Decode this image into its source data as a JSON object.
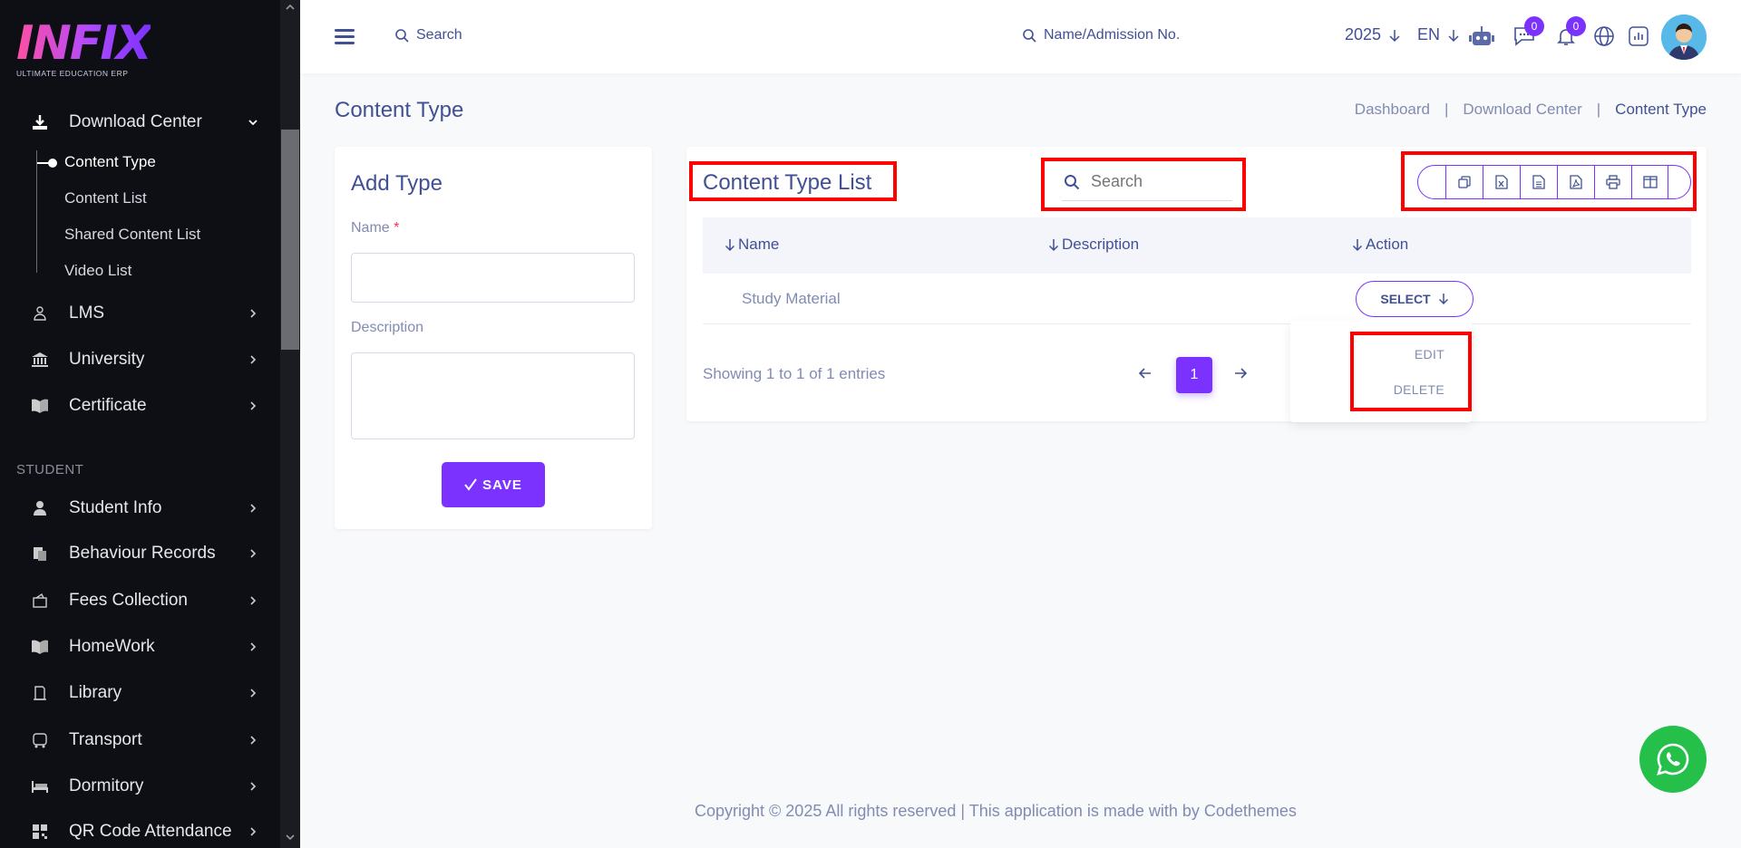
{
  "brand": {
    "logo_text": "INFIX",
    "tagline": "ULTIMATE EDUCATION ERP"
  },
  "sidebar": {
    "open_section": {
      "label": "Download Center",
      "icon": "download-icon"
    },
    "sub_items": [
      {
        "label": "Content Type",
        "active": true
      },
      {
        "label": "Content List"
      },
      {
        "label": "Shared Content List"
      },
      {
        "label": "Video List"
      }
    ],
    "items_top": [
      {
        "label": "LMS",
        "icon": "lms-icon"
      },
      {
        "label": "University",
        "icon": "university-icon"
      },
      {
        "label": "Certificate",
        "icon": "certificate-icon"
      }
    ],
    "section_student": "STUDENT",
    "items_student": [
      {
        "label": "Student Info",
        "icon": "student-icon"
      },
      {
        "label": "Behaviour Records",
        "icon": "behaviour-icon"
      },
      {
        "label": "Fees Collection",
        "icon": "fees-icon"
      },
      {
        "label": "HomeWork",
        "icon": "homework-icon"
      },
      {
        "label": "Library",
        "icon": "library-icon"
      },
      {
        "label": "Transport",
        "icon": "transport-icon"
      },
      {
        "label": "Dormitory",
        "icon": "dormitory-icon"
      },
      {
        "label": "QR Code Attendance",
        "icon": "qr-code-icon"
      }
    ]
  },
  "header": {
    "search_label": "Search",
    "student_search_label": "Name/Admission No.",
    "year": "2025",
    "language": "EN",
    "message_count": "0",
    "notification_count": "0"
  },
  "page": {
    "title": "Content Type",
    "breadcrumb": [
      "Dashboard",
      "Download Center",
      "Content Type"
    ],
    "separator": "|"
  },
  "add_form": {
    "title": "Add Type",
    "name_label": "Name",
    "required_mark": "*",
    "name_value": "",
    "description_label": "Description",
    "description_value": "",
    "save_label": "SAVE",
    "save_icon": "check-icon"
  },
  "list": {
    "title": "Content Type List",
    "search_placeholder": "Search",
    "export_buttons": [
      "copy-icon",
      "excel-icon",
      "csv-icon",
      "pdf-icon",
      "print-icon",
      "columns-icon"
    ],
    "columns": [
      "Name",
      "Description",
      "Action"
    ],
    "rows": [
      {
        "name": "Study Material",
        "description": ""
      }
    ],
    "select_label": "SELECT",
    "dropdown_items": [
      "EDIT",
      "DELETE"
    ],
    "showing_text": "Showing 1 to 1 of 1 entries",
    "current_page": "1"
  },
  "footer": {
    "text": "Copyright © 2025 All rights reserved | This application is made with by Codethemes"
  },
  "colors": {
    "accent": "#7c32ff",
    "text_primary": "#415094",
    "text_muted": "#828bb2",
    "sidebar_bg": "#0e0f14",
    "highlight": "#ff0000",
    "whatsapp": "#25c04a"
  }
}
